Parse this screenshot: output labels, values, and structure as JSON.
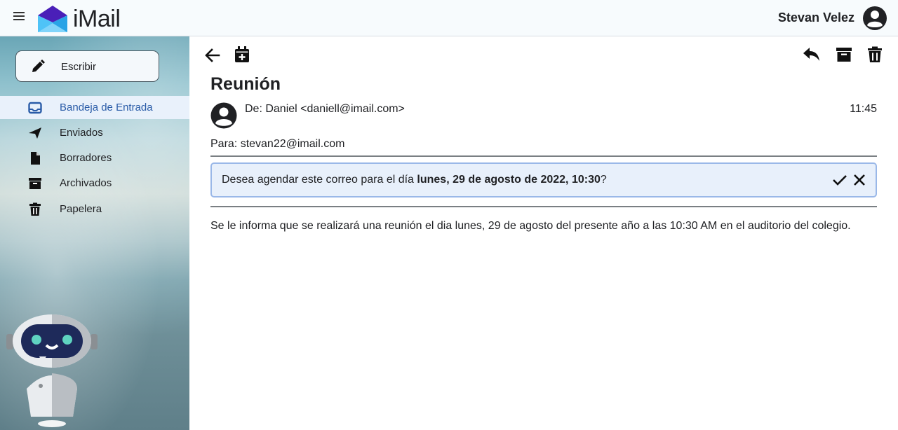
{
  "app": {
    "name": "iMail"
  },
  "user": {
    "name": "Stevan Velez"
  },
  "sidebar": {
    "compose_label": "Escribir",
    "items": [
      {
        "label": "Bandeja de Entrada",
        "icon": "inbox-icon",
        "active": true
      },
      {
        "label": "Enviados",
        "icon": "send-icon",
        "active": false
      },
      {
        "label": "Borradores",
        "icon": "draft-icon",
        "active": false
      },
      {
        "label": "Archivados",
        "icon": "archive-icon",
        "active": false
      },
      {
        "label": "Papelera",
        "icon": "trash-icon",
        "active": false
      }
    ]
  },
  "email": {
    "subject": "Reunión",
    "from": "De: Daniel <daniell@imail.com>",
    "time": "11:45",
    "to": "Para: stevan22@imail.com",
    "schedule_prompt": {
      "prefix": "Desea agendar este correo para el día ",
      "date": "lunes, 29 de agosto de 2022, 10:30",
      "suffix": "?"
    },
    "body": "Se le informa que se realizará una reunión el dia lunes, 29 de agosto del presente año a las 10:30 AM en el auditorio del colegio."
  },
  "colors": {
    "accent": "#2a5ca8",
    "banner_bg": "#e8f0fb",
    "banner_border": "#9ab8e8"
  }
}
